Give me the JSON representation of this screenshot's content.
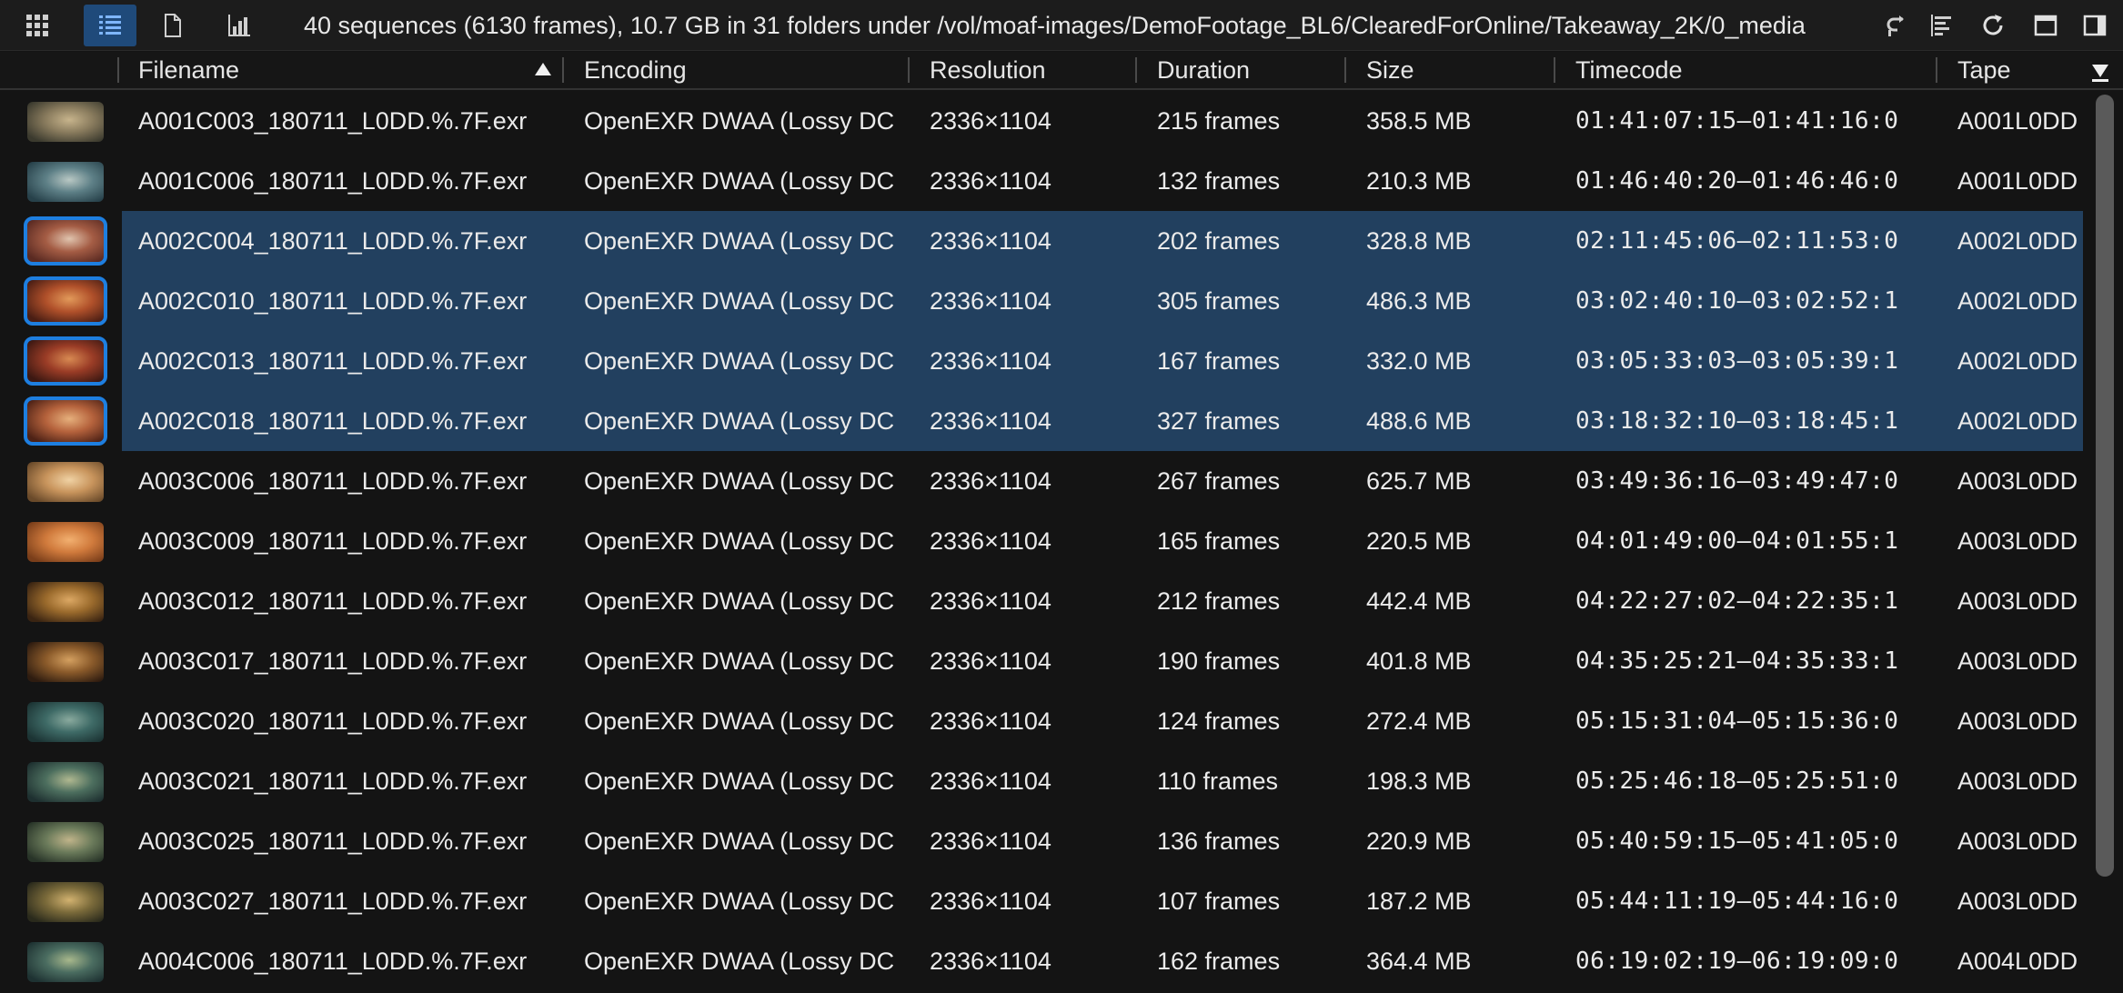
{
  "toolbar": {
    "status": "40 sequences (6130 frames), 10.7 GB in 31 folders under /vol/moaf-images/DemoFootage_BL6/ClearedForOnline/Takeaway_2K/0_media",
    "left_buttons": [
      {
        "icon": "grid-icon",
        "active": false
      },
      {
        "icon": "list-view-icon",
        "active": true
      },
      {
        "icon": "document-icon",
        "active": false
      },
      {
        "icon": "bar-chart-icon",
        "active": false
      }
    ],
    "right_buttons": [
      {
        "icon": "return-arrow-icon"
      },
      {
        "icon": "align-left-icon"
      },
      {
        "icon": "refresh-icon"
      },
      {
        "icon": "window-icon"
      },
      {
        "icon": "sidebar-toggle-icon"
      }
    ]
  },
  "columns": {
    "filename": "Filename",
    "encoding": "Encoding",
    "resolution": "Resolution",
    "duration": "Duration",
    "size": "Size",
    "timecode": "Timecode",
    "tape": "Tape"
  },
  "rows": [
    {
      "filename": "A001C003_180711_L0DD.%.7F.exr",
      "encoding": "OpenEXR DWAA (Lossy DC",
      "resolution": "2336×1104",
      "duration": "215 frames",
      "size": "358.5 MB",
      "timecode": "01:41:07:15–01:41:16:0",
      "tape": "A001L0DD",
      "selected": false,
      "thumb": [
        "#3b3a2e",
        "#8a7c5e",
        "#c7b48c"
      ]
    },
    {
      "filename": "A001C006_180711_L0DD.%.7F.exr",
      "encoding": "OpenEXR DWAA (Lossy DC",
      "resolution": "2336×1104",
      "duration": "132 frames",
      "size": "210.3 MB",
      "timecode": "01:46:40:20–01:46:46:0",
      "tape": "A001L0DD",
      "selected": false,
      "thumb": [
        "#27414a",
        "#5d7f86",
        "#b9c8c4"
      ]
    },
    {
      "filename": "A002C004_180711_L0DD.%.7F.exr",
      "encoding": "OpenEXR DWAA (Lossy DC",
      "resolution": "2336×1104",
      "duration": "202 frames",
      "size": "328.8 MB",
      "timecode": "02:11:45:06–02:11:53:0",
      "tape": "A002L0DD",
      "selected": true,
      "thumb": [
        "#5a2a22",
        "#a45c44",
        "#e0c4ae"
      ]
    },
    {
      "filename": "A002C010_180711_L0DD.%.7F.exr",
      "encoding": "OpenEXR DWAA (Lossy DC",
      "resolution": "2336×1104",
      "duration": "305 frames",
      "size": "486.3 MB",
      "timecode": "03:02:40:10–03:02:52:1",
      "tape": "A002L0DD",
      "selected": true,
      "thumb": [
        "#4a1e14",
        "#b0502a",
        "#e29a5a"
      ]
    },
    {
      "filename": "A002C013_180711_L0DD.%.7F.exr",
      "encoding": "OpenEXR DWAA (Lossy DC",
      "resolution": "2336×1104",
      "duration": "167 frames",
      "size": "332.0 MB",
      "timecode": "03:05:33:03–03:05:39:1",
      "tape": "A002L0DD",
      "selected": true,
      "thumb": [
        "#3c1812",
        "#9a3c26",
        "#d88a52"
      ]
    },
    {
      "filename": "A002C018_180711_L0DD.%.7F.exr",
      "encoding": "OpenEXR DWAA (Lossy DC",
      "resolution": "2336×1104",
      "duration": "327 frames",
      "size": "488.6 MB",
      "timecode": "03:18:32:10–03:18:45:1",
      "tape": "A002L0DD",
      "selected": true,
      "thumb": [
        "#4e2216",
        "#b5623c",
        "#e6b07c"
      ]
    },
    {
      "filename": "A003C006_180711_L0DD.%.7F.exr",
      "encoding": "OpenEXR DWAA (Lossy DC",
      "resolution": "2336×1104",
      "duration": "267 frames",
      "size": "625.7 MB",
      "timecode": "03:49:36:16–03:49:47:0",
      "tape": "A003L0DD",
      "selected": false,
      "thumb": [
        "#6a4a2a",
        "#c8945c",
        "#f0d2a4"
      ]
    },
    {
      "filename": "A003C009_180711_L0DD.%.7F.exr",
      "encoding": "OpenEXR DWAA (Lossy DC",
      "resolution": "2336×1104",
      "duration": "165 frames",
      "size": "220.5 MB",
      "timecode": "04:01:49:00–04:01:55:1",
      "tape": "A003L0DD",
      "selected": false,
      "thumb": [
        "#7a3e1a",
        "#d07a3c",
        "#f2b070"
      ]
    },
    {
      "filename": "A003C012_180711_L0DD.%.7F.exr",
      "encoding": "OpenEXR DWAA (Lossy DC",
      "resolution": "2336×1104",
      "duration": "212 frames",
      "size": "442.4 MB",
      "timecode": "04:22:27:02–04:22:35:1",
      "tape": "A003L0DD",
      "selected": false,
      "thumb": [
        "#3a2412",
        "#9a6a2c",
        "#dca864"
      ]
    },
    {
      "filename": "A003C017_180711_L0DD.%.7F.exr",
      "encoding": "OpenEXR DWAA (Lossy DC",
      "resolution": "2336×1104",
      "duration": "190 frames",
      "size": "401.8 MB",
      "timecode": "04:35:25:21–04:35:33:1",
      "tape": "A003L0DD",
      "selected": false,
      "thumb": [
        "#2e1c10",
        "#8a5a2a",
        "#d4a060"
      ]
    },
    {
      "filename": "A003C020_180711_L0DD.%.7F.exr",
      "encoding": "OpenEXR DWAA (Lossy DC",
      "resolution": "2336×1104",
      "duration": "124 frames",
      "size": "272.4 MB",
      "timecode": "05:15:31:04–05:15:36:0",
      "tape": "A003L0DD",
      "selected": false,
      "thumb": [
        "#1c3434",
        "#3e6a66",
        "#8aaa9e"
      ]
    },
    {
      "filename": "A003C021_180711_L0DD.%.7F.exr",
      "encoding": "OpenEXR DWAA (Lossy DC",
      "resolution": "2336×1104",
      "duration": "110 frames",
      "size": "198.3 MB",
      "timecode": "05:25:46:18–05:25:51:0",
      "tape": "A003L0DD",
      "selected": false,
      "thumb": [
        "#1e3030",
        "#4c6e5e",
        "#b0b890"
      ]
    },
    {
      "filename": "A003C025_180711_L0DD.%.7F.exr",
      "encoding": "OpenEXR DWAA (Lossy DC",
      "resolution": "2336×1104",
      "duration": "136 frames",
      "size": "220.9 MB",
      "timecode": "05:40:59:15–05:41:05:0",
      "tape": "A003L0DD",
      "selected": false,
      "thumb": [
        "#283428",
        "#6a7a5a",
        "#c0b48a"
      ]
    },
    {
      "filename": "A003C027_180711_L0DD.%.7F.exr",
      "encoding": "OpenEXR DWAA (Lossy DC",
      "resolution": "2336×1104",
      "duration": "107 frames",
      "size": "187.2 MB",
      "timecode": "05:44:11:19–05:44:16:0",
      "tape": "A003L0DD",
      "selected": false,
      "thumb": [
        "#2a2a1c",
        "#7a6a3a",
        "#d2b270"
      ]
    },
    {
      "filename": "A004C006_180711_L0DD.%.7F.exr",
      "encoding": "OpenEXR DWAA (Lossy DC",
      "resolution": "2336×1104",
      "duration": "162 frames",
      "size": "364.4 MB",
      "timecode": "06:19:02:19–06:19:09:0",
      "tape": "A004L0DD",
      "selected": false,
      "thumb": [
        "#1e3232",
        "#4a6c60",
        "#a8b88c"
      ]
    }
  ]
}
